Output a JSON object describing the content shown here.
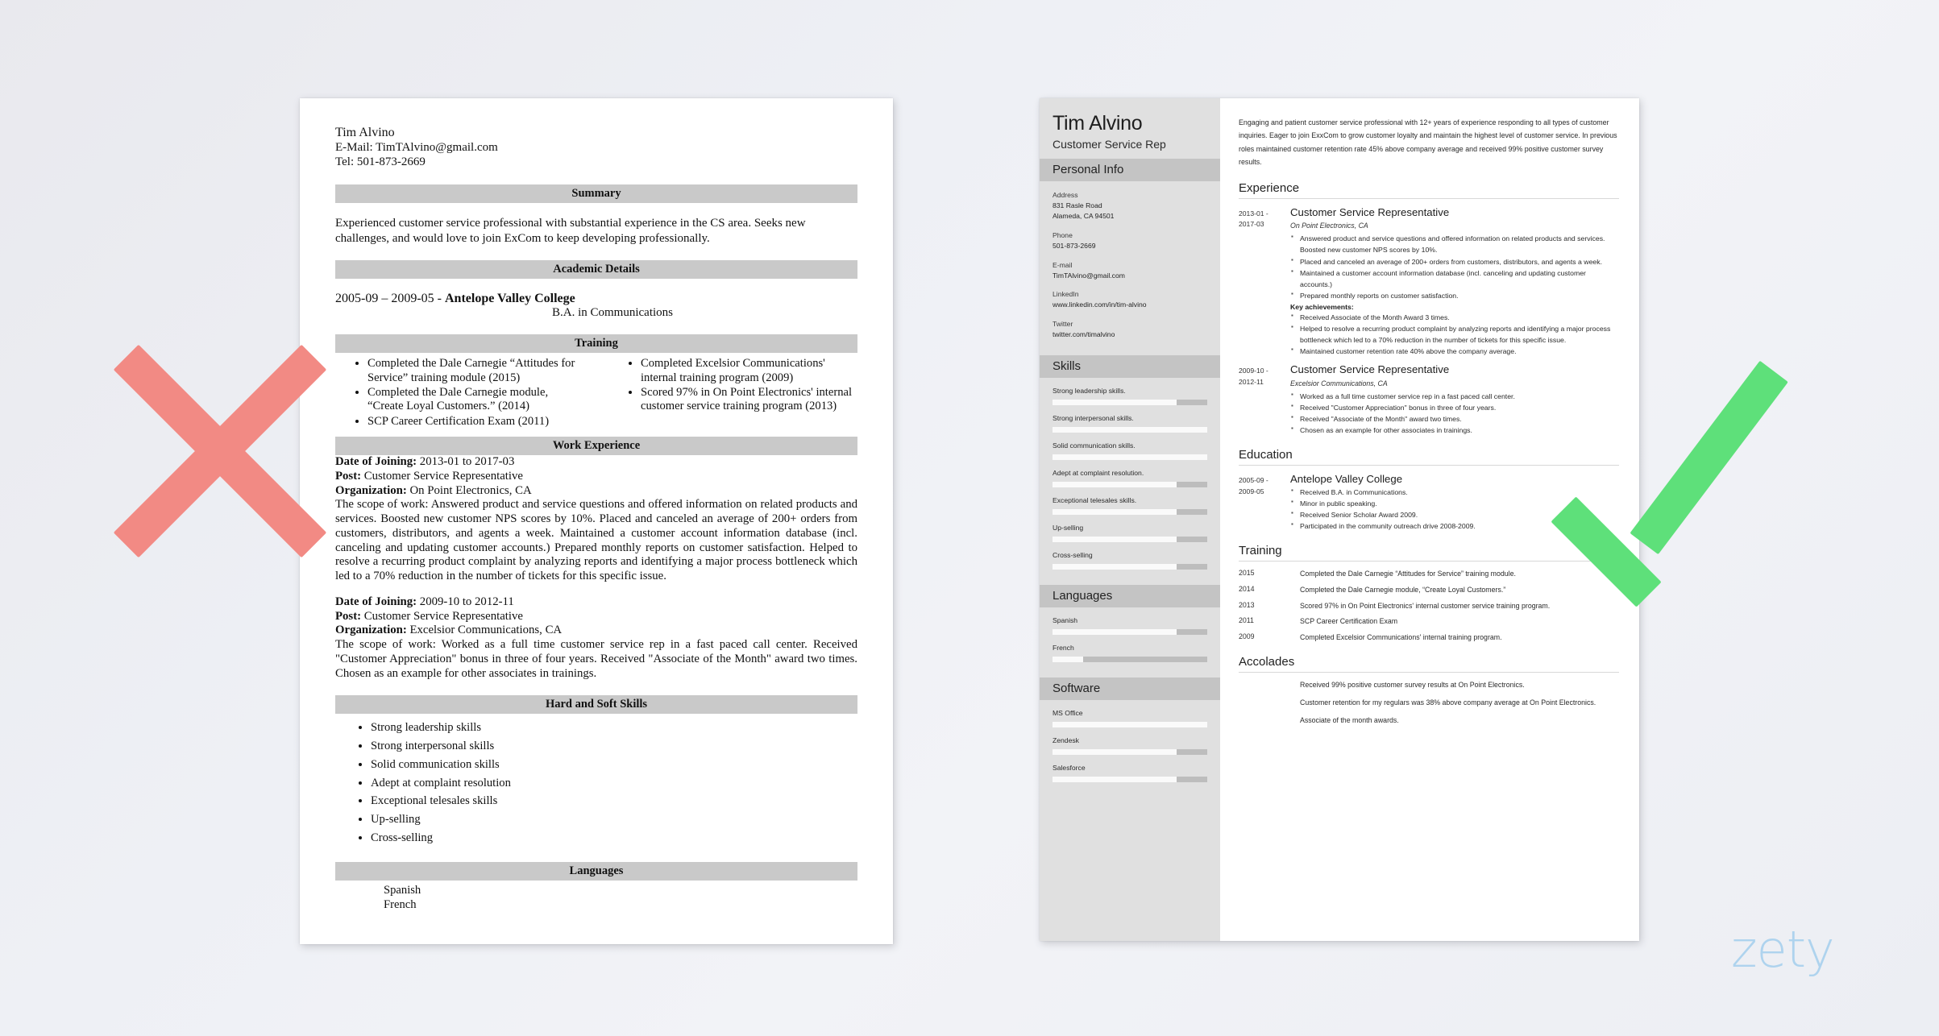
{
  "colors": {
    "x_mark": "#f28a84",
    "check_mark": "#5ee07a",
    "logo": "#a9d1ee",
    "section_bar_bad": "#c9c9c9",
    "sidebar": "#e0e0e0",
    "sidebar_bar": "#c4c4c4"
  },
  "brand": {
    "logo_text": "zety"
  },
  "bad_resume": {
    "name": "Tim Alvino",
    "email_line": "E-Mail: TimTAlvino@gmail.com",
    "tel_line": "Tel: 501-873-2669",
    "sections": {
      "summary_heading": "Summary",
      "summary_text": "Experienced customer service professional with substantial experience in the CS area. Seeks new challenges, and would love to join ExCom to keep developing professionally.",
      "academic_heading": "Academic Details",
      "academic_dates": "2005-09 – 2009-05 - ",
      "academic_school": "Antelope Valley College",
      "academic_degree": "B.A. in Communications",
      "training_heading": "Training",
      "training_left": [
        "Completed the Dale Carnegie “Attitudes for Service” training module (2015)",
        "Completed the Dale Carnegie module, “Create Loyal Customers.” (2014)",
        "SCP Career Certification Exam (2011)"
      ],
      "training_right": [
        "Completed Excelsior Communications' internal training program (2009)",
        "Scored 97% in On Point Electronics' internal customer service training program (2013)"
      ],
      "work_heading": "Work Experience",
      "jobs": [
        {
          "date_label": "Date of Joining:",
          "date_value": " 2013-01 to 2017-03",
          "post_label": "Post:",
          "post_value": " Customer Service Representative",
          "org_label": "Organization:",
          "org_value": " On Point Electronics, CA",
          "scope_label": "The scope of work:",
          "scope_value": " Answered product and service questions and offered information on related products and services. Boosted new customer NPS scores by 10%. Placed and canceled an average of 200+ orders from customers, distributors, and agents a week. Maintained a customer account information database (incl. canceling and updating customer accounts.) Prepared monthly reports on customer satisfaction. Helped to resolve a recurring product complaint by analyzing reports and identifying a major process bottleneck which led to a 70% reduction in the number of tickets for this specific issue."
        },
        {
          "date_label": "Date of Joining:",
          "date_value": " 2009-10 to 2012-11",
          "post_label": "Post:",
          "post_value": " Customer Service Representative",
          "org_label": "Organization:",
          "org_value": " Excelsior Communications, CA",
          "scope_label": "The scope of work:",
          "scope_value": " Worked as a full time customer service rep in a fast paced call center. Received \"Customer Appreciation\" bonus in three of four years. Received \"Associate of the Month\" award two times. Chosen as an example for other associates in trainings."
        }
      ],
      "skills_heading": "Hard and Soft Skills",
      "skills": [
        "Strong leadership skills",
        "Strong interpersonal skills",
        "Solid communication skills",
        "Adept at complaint resolution",
        "Exceptional telesales skills",
        "Up-selling",
        "Cross-selling"
      ],
      "languages_heading": "Languages",
      "languages": [
        "Spanish",
        "French"
      ]
    }
  },
  "good_resume": {
    "sidebar": {
      "name": "Tim Alvino",
      "job_title": "Customer Service Rep",
      "personal_info_heading": "Personal Info",
      "fields": [
        {
          "label": "Address",
          "values": [
            "831 Rasle Road",
            "Alameda, CA 94501"
          ]
        },
        {
          "label": "Phone",
          "values": [
            "501-873-2669"
          ]
        },
        {
          "label": "E-mail",
          "values": [
            "TimTAlvino@gmail.com"
          ]
        },
        {
          "label": "LinkedIn",
          "values": [
            "www.linkedin.com/in/tim-alvino"
          ]
        },
        {
          "label": "Twitter",
          "values": [
            "twitter.com/timalvino"
          ]
        }
      ],
      "skills_heading": "Skills",
      "skills": [
        {
          "label": "Strong leadership skills.",
          "level": 80
        },
        {
          "label": "Strong interpersonal skills.",
          "level": 100
        },
        {
          "label": "Solid communication skills.",
          "level": 100
        },
        {
          "label": "Adept at complaint resolution.",
          "level": 80
        },
        {
          "label": "Exceptional telesales skills.",
          "level": 80
        },
        {
          "label": "Up-selling",
          "level": 80
        },
        {
          "label": "Cross-selling",
          "level": 80
        }
      ],
      "languages_heading": "Languages",
      "languages": [
        {
          "label": "Spanish",
          "level": 80
        },
        {
          "label": "French",
          "level": 20
        }
      ],
      "software_heading": "Software",
      "software": [
        {
          "label": "MS Office",
          "level": 100
        },
        {
          "label": "Zendesk",
          "level": 80
        },
        {
          "label": "Salesforce",
          "level": 80
        }
      ]
    },
    "main": {
      "summary": "Engaging and patient customer service professional with 12+ years of experience responding to all types of customer inquiries. Eager to join ExxCom to grow customer loyalty and maintain the highest level of customer service. In previous roles maintained customer retention rate 45% above company average and received 99% positive customer survey results.",
      "experience_heading": "Experience",
      "experience": [
        {
          "dates": [
            "2013-01 -",
            "2017-03"
          ],
          "title": "Customer Service Representative",
          "org": "On Point Electronics, CA",
          "bullets": [
            "Answered product and service questions and offered information on related products and services. Boosted new customer NPS scores by 10%.",
            "Placed and canceled an average of 200+ orders from customers, distributors, and agents a week.",
            "Maintained a customer account information database (incl. canceling and updating customer accounts.)",
            "Prepared monthly reports on customer satisfaction."
          ],
          "key_label": "Key achievements:",
          "key_bullets": [
            "Received Associate of the Month Award 3 times.",
            "Helped to resolve a recurring product complaint by analyzing reports and identifying a major process bottleneck which led to a 70% reduction in the number of tickets for this specific issue.",
            "Maintained customer retention rate 40% above the company average."
          ]
        },
        {
          "dates": [
            "2009-10 -",
            "2012-11"
          ],
          "title": "Customer Service Representative",
          "org": "Excelsior Communications, CA",
          "bullets": [
            "Worked as a full time customer service rep in a fast paced call center.",
            "Received \"Customer Appreciation\" bonus in three of four years.",
            "Received \"Associate of the Month\" award two times.",
            "Chosen as an example for other associates in trainings."
          ],
          "key_label": "",
          "key_bullets": []
        }
      ],
      "education_heading": "Education",
      "education": [
        {
          "dates": [
            "2005-09 -",
            "2009-05"
          ],
          "title": "Antelope Valley College",
          "bullets": [
            "Received B.A. in Communications.",
            "Minor in public speaking.",
            "Received Senior Scholar Award 2009.",
            "Participated in the community outreach drive 2008-2009."
          ]
        }
      ],
      "training_heading": "Training",
      "training": [
        {
          "year": "2015",
          "text": "Completed the Dale Carnegie “Attitudes for Service” training module."
        },
        {
          "year": "2014",
          "text": "Completed the Dale Carnegie module, “Create Loyal Customers.”"
        },
        {
          "year": "2013",
          "text": "Scored 97% in On Point Electronics' internal customer service training program."
        },
        {
          "year": "2011",
          "text": "SCP Career Certification Exam"
        },
        {
          "year": "2009",
          "text": "Completed Excelsior Communications' internal training program."
        }
      ],
      "accolades_heading": "Accolades",
      "accolades": [
        "Received 99% positive customer survey results at On Point Electronics.",
        "Customer retention for my regulars was 38% above company average at On Point Electronics.",
        "Associate of the month awards."
      ]
    }
  }
}
